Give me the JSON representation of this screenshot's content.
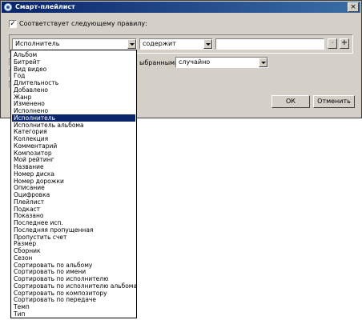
{
  "window": {
    "title": "Смарт-плейлист",
    "close_glyph": "×",
    "match_rule_checked": true,
    "match_rule_label": "Соответствует следующему правилу:"
  },
  "rule": {
    "field_value": "Исполнитель",
    "operator_value": "содержит",
    "text_value": "",
    "remove_label": "-",
    "add_label": "+"
  },
  "limit_row": {
    "partial_label": "ыбранными",
    "order_value": "случайно"
  },
  "buttons": {
    "ok": "ОК",
    "cancel": "Отменить"
  },
  "field_options": [
    "Альбом",
    "Битрейт",
    "Вид видео",
    "Год",
    "Длительность",
    "Добавлено",
    "Жанр",
    "Изменено",
    "Исполнено",
    "Исполнитель",
    "Исполнитель альбома",
    "Категория",
    "Коллекция",
    "Комментарий",
    "Композитор",
    "Мой рейтинг",
    "Название",
    "Номер диска",
    "Номер дорожки",
    "Описание",
    "Оцифровка",
    "Плейлист",
    "Подкаст",
    "Показано",
    "Последнее исп.",
    "Последняя пропущенная",
    "Пропустить счет",
    "Размер",
    "Сборник",
    "Сезон",
    "Сортировать по альбому",
    "Сортировать по имени",
    "Сортировать по исполнителю",
    "Сортировать по исполнителю альбома",
    "Сортировать по композитору",
    "Сортировать по передаче",
    "Темп",
    "Тип"
  ],
  "selected_option": "Исполнитель"
}
